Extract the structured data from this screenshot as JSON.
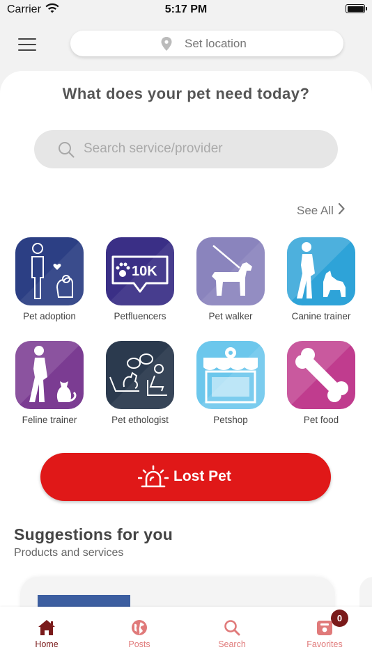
{
  "status_bar": {
    "carrier": "Carrier",
    "time": "5:17 PM"
  },
  "header": {
    "location_label": "Set location"
  },
  "main": {
    "heading": "What does your pet need today?",
    "search_placeholder": "Search service/provider",
    "see_all": "See All"
  },
  "categories": [
    {
      "label": "Pet adoption",
      "color": "#2c3f84",
      "icon": "person-dog-heart-icon"
    },
    {
      "label": "Petfluencers",
      "color": "#3a2f86",
      "icon": "10k-sign-icon",
      "icon_text": "10K"
    },
    {
      "label": "Pet walker",
      "color": "#8a84bd",
      "icon": "dog-on-leash-icon"
    },
    {
      "label": "Canine trainer",
      "color": "#2ea3d8",
      "icon": "trainer-with-dog-icon"
    },
    {
      "label": "Feline trainer",
      "color": "#7b3c92",
      "icon": "trainer-with-cat-icon"
    },
    {
      "label": "Pet ethologist",
      "color": "#2b3a4e",
      "icon": "dog-on-couch-icon"
    },
    {
      "label": "Petshop",
      "color": "#6cc7ec",
      "icon": "storefront-icon"
    },
    {
      "label": "Pet food",
      "color": "#c03c8e",
      "icon": "bone-icon"
    }
  ],
  "lost_pet": {
    "label": "Lost Pet",
    "color": "#e01818"
  },
  "suggestions": {
    "title": "Suggestions for you",
    "subtitle": "Products and services"
  },
  "tabbar": {
    "items": [
      {
        "label": "Home",
        "icon": "home-icon",
        "active": true
      },
      {
        "label": "Posts",
        "icon": "globe-icon",
        "active": false
      },
      {
        "label": "Search",
        "icon": "search-icon",
        "active": false
      },
      {
        "label": "Favorites",
        "icon": "favorites-icon",
        "active": false
      }
    ],
    "favorites_badge": "0"
  }
}
